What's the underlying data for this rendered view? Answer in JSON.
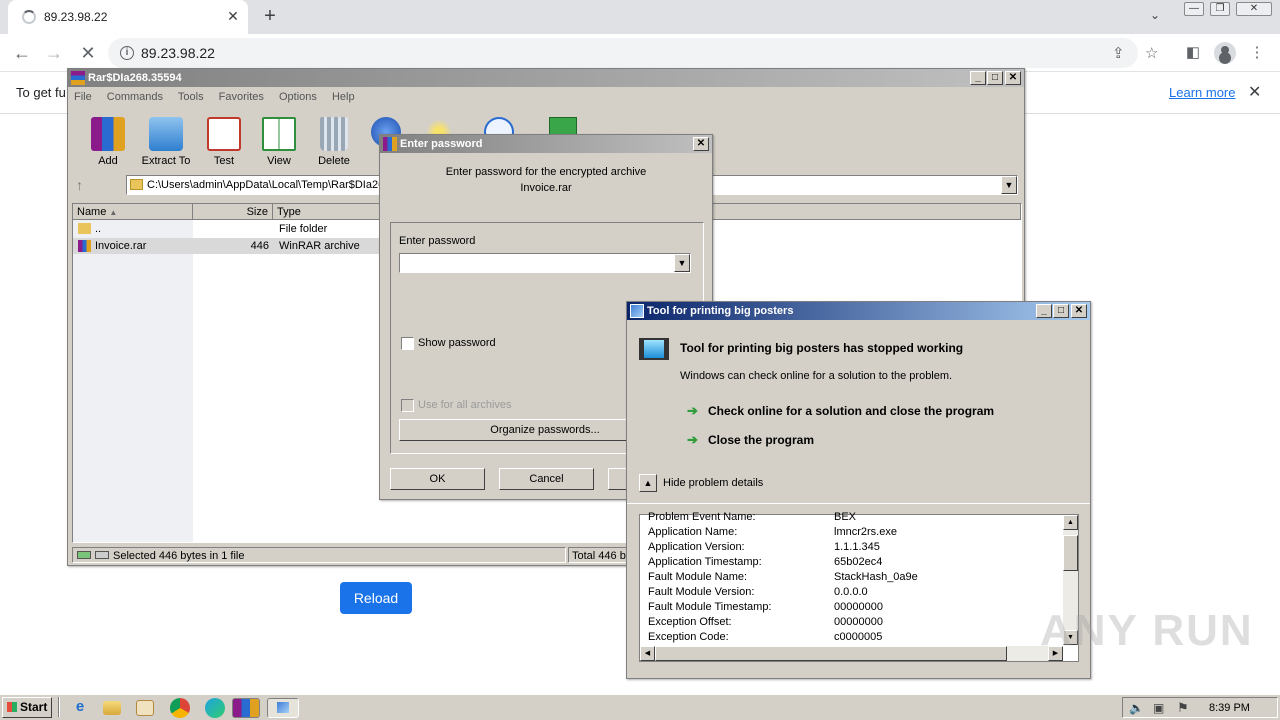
{
  "browser": {
    "tab_title": "89.23.98.22",
    "url": "89.23.98.22",
    "infobar_text": "To get fu",
    "learn_more": "Learn more",
    "reload_label": "Reload"
  },
  "winrar": {
    "title": "Rar$DIa268.35594",
    "menu": [
      "File",
      "Commands",
      "Tools",
      "Favorites",
      "Options",
      "Help"
    ],
    "tools": [
      "Add",
      "Extract To",
      "Test",
      "View",
      "Delete"
    ],
    "path": "C:\\Users\\admin\\AppData\\Local\\Temp\\Rar$DIa26",
    "columns": [
      "Name",
      "Size",
      "Type"
    ],
    "files": [
      {
        "name": "..",
        "size": "",
        "type": "File folder"
      },
      {
        "name": "Invoice.rar",
        "size": "446",
        "type": "WinRAR archive"
      }
    ],
    "status_left": "Selected 446 bytes in 1 file",
    "status_right": "Total 446 b"
  },
  "password_dialog": {
    "title": "Enter password",
    "message_line1": "Enter password for the encrypted archive",
    "message_line2": "Invoice.rar",
    "field_label": "Enter password",
    "show_password": "Show password",
    "use_all": "Use for all archives",
    "organize": "Organize passwords...",
    "ok": "OK",
    "cancel": "Cancel"
  },
  "crash_dialog": {
    "title": "Tool for printing big posters",
    "heading": "Tool for printing big posters has stopped working",
    "subtext": "Windows can check online for a solution to the problem.",
    "option1": "Check online for a solution and close the program",
    "option2": "Close the program",
    "toggle": "Hide problem details",
    "details": [
      {
        "k": "Problem Event Name:",
        "v": "BEX"
      },
      {
        "k": "Application Name:",
        "v": "lmncr2rs.exe"
      },
      {
        "k": "Application Version:",
        "v": "1.1.1.345"
      },
      {
        "k": "Application Timestamp:",
        "v": "65b02ec4"
      },
      {
        "k": "Fault Module Name:",
        "v": "StackHash_0a9e"
      },
      {
        "k": "Fault Module Version:",
        "v": "0.0.0.0"
      },
      {
        "k": "Fault Module Timestamp:",
        "v": "00000000"
      },
      {
        "k": "Exception Offset:",
        "v": "00000000"
      },
      {
        "k": "Exception Code:",
        "v": "c0000005"
      }
    ]
  },
  "taskbar": {
    "start": "Start",
    "clock": "8:39 PM"
  },
  "watermark": "ANY RUN"
}
